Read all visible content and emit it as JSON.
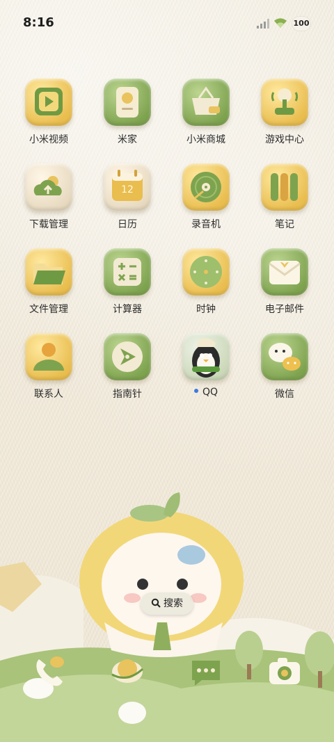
{
  "status_bar": {
    "time": "8:16",
    "battery": "100"
  },
  "apps": [
    {
      "label": "小米视频",
      "icon": "video-play-icon"
    },
    {
      "label": "米家",
      "icon": "smart-home-icon"
    },
    {
      "label": "小米商城",
      "icon": "shopping-basket-icon"
    },
    {
      "label": "游戏中心",
      "icon": "game-controller-icon"
    },
    {
      "label": "下载管理",
      "icon": "cloud-download-icon"
    },
    {
      "label": "日历",
      "icon": "calendar-icon",
      "day": "12"
    },
    {
      "label": "录音机",
      "icon": "recorder-icon"
    },
    {
      "label": "笔记",
      "icon": "notes-icon"
    },
    {
      "label": "文件管理",
      "icon": "folder-icon"
    },
    {
      "label": "计算器",
      "icon": "calculator-icon"
    },
    {
      "label": "时钟",
      "icon": "clock-icon"
    },
    {
      "label": "电子邮件",
      "icon": "mail-icon"
    },
    {
      "label": "联系人",
      "icon": "contacts-icon"
    },
    {
      "label": "指南针",
      "icon": "compass-icon"
    },
    {
      "label": "QQ",
      "icon": "qq-penguin-icon",
      "has_notification_dot": true
    },
    {
      "label": "微信",
      "icon": "wechat-icon"
    }
  ],
  "search": {
    "label": "搜索",
    "icon": "search-icon"
  },
  "dock": [
    {
      "icon": "phone-icon"
    },
    {
      "icon": "browser-planet-icon"
    },
    {
      "icon": "messages-icon"
    },
    {
      "icon": "camera-icon"
    }
  ],
  "colors": {
    "background": "#f1ebdd",
    "felt_yellow": "#e9bd4e",
    "felt_green": "#7ea34f",
    "felt_cream": "#e6d8be",
    "label_text": "#2c2c2c",
    "notification_dot": "#3a7be0"
  }
}
